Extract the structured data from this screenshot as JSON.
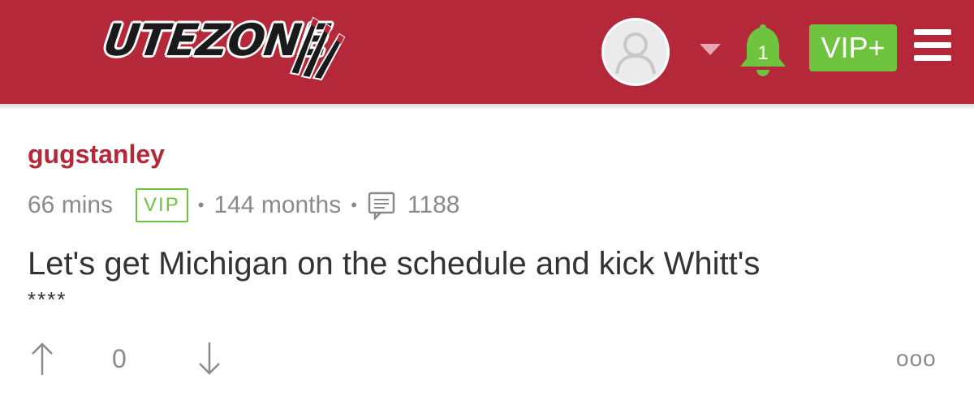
{
  "header": {
    "logo_text": "UTEZONE",
    "notification_count": "1",
    "vip_plus_label": "VIP+",
    "colors": {
      "header_bg": "#b5283a",
      "accent_green": "#6ec33f"
    },
    "icons": [
      "avatar-icon",
      "caret-down-icon",
      "bell-icon",
      "hamburger-menu-icon"
    ]
  },
  "post": {
    "username": "gugstanley",
    "time_ago": "66 mins",
    "badge": "VIP",
    "tenure": "144 months",
    "post_count": "1188",
    "body": "Let's get Michigan on the schedule and kick Whitt's",
    "body_censored": "****",
    "vote_count": "0",
    "more_label": "ooo"
  }
}
